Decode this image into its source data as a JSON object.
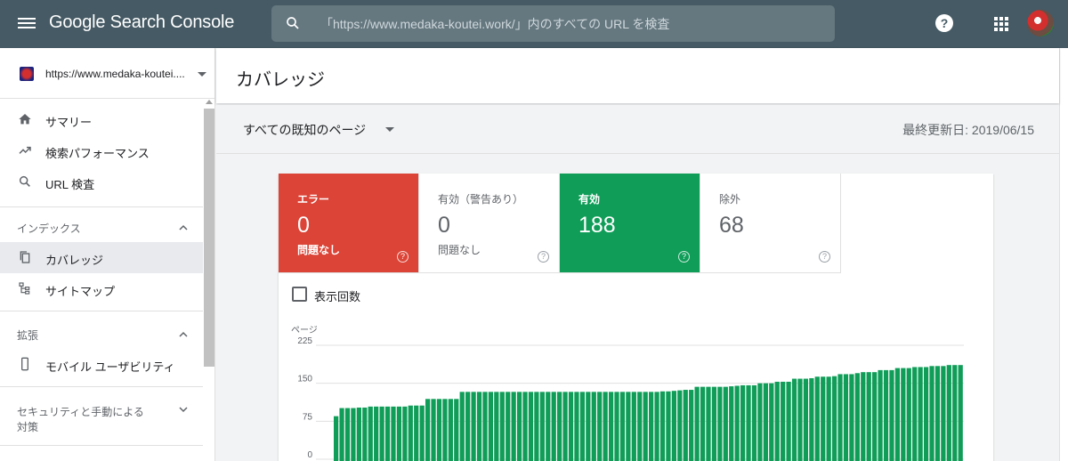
{
  "app": {
    "title": "Google Search Console"
  },
  "search": {
    "placeholder": "「https://www.medaka-koutei.work/」内のすべての URL を検査"
  },
  "property": {
    "label": "https://www.medaka-koutei...."
  },
  "sidebar": {
    "items": [
      {
        "label": "サマリー",
        "icon": "home-icon"
      },
      {
        "label": "検索パフォーマンス",
        "icon": "trending-up-icon"
      },
      {
        "label": "URL 検査",
        "icon": "search-icon"
      }
    ],
    "index_section": {
      "label": "インデックス",
      "items": [
        {
          "label": "カバレッジ",
          "icon": "coverage-icon",
          "active": true
        },
        {
          "label": "サイトマップ",
          "icon": "sitemap-icon"
        }
      ]
    },
    "enhancements_section": {
      "label": "拡張",
      "items": [
        {
          "label": "モバイル ユーザビリティ",
          "icon": "mobile-icon"
        }
      ]
    },
    "security_section": {
      "label_line1": "セキュリティと手動による",
      "label_line2": "対策"
    }
  },
  "page": {
    "title": "カバレッジ",
    "filter": "すべての既知のページ",
    "last_updated": "最終更新日: 2019/06/15"
  },
  "status_tiles": [
    {
      "label": "エラー",
      "value": "0",
      "sub": "問題なし",
      "color": "#db4437"
    },
    {
      "label": "有効（警告あり）",
      "value": "0",
      "sub": "問題なし",
      "color": "#ffffff"
    },
    {
      "label": "有効",
      "value": "188",
      "sub": "",
      "color": "#0f9d58"
    },
    {
      "label": "除外",
      "value": "68",
      "sub": "",
      "color": "#ffffff"
    }
  ],
  "impressions_toggle": {
    "label": "表示回数",
    "checked": false
  },
  "chart_data": {
    "type": "bar",
    "ylabel": "ページ",
    "ylim": [
      0,
      225
    ],
    "yticks": [
      "225",
      "150",
      "75",
      "0"
    ],
    "color": "#0f9d58",
    "values": [
      85,
      101,
      101,
      101,
      102,
      102,
      104,
      104,
      104,
      104,
      104,
      104,
      104,
      106,
      106,
      106,
      119,
      119,
      119,
      119,
      119,
      119,
      133,
      133,
      133,
      133,
      133,
      133,
      133,
      133,
      133,
      133,
      133,
      133,
      133,
      133,
      133,
      133,
      133,
      133,
      133,
      133,
      133,
      133,
      133,
      133,
      133,
      133,
      133,
      133,
      133,
      133,
      133,
      133,
      133,
      133,
      133,
      134,
      134,
      135,
      136,
      137,
      137,
      143,
      143,
      143,
      143,
      143,
      143,
      144,
      145,
      146,
      146,
      146,
      150,
      150,
      150,
      153,
      153,
      153,
      159,
      159,
      159,
      160,
      163,
      163,
      163,
      164,
      168,
      168,
      168,
      170,
      172,
      172,
      172,
      176,
      176,
      176,
      180,
      180,
      180,
      182,
      182,
      182,
      184,
      184,
      184,
      186,
      186,
      186
    ]
  }
}
